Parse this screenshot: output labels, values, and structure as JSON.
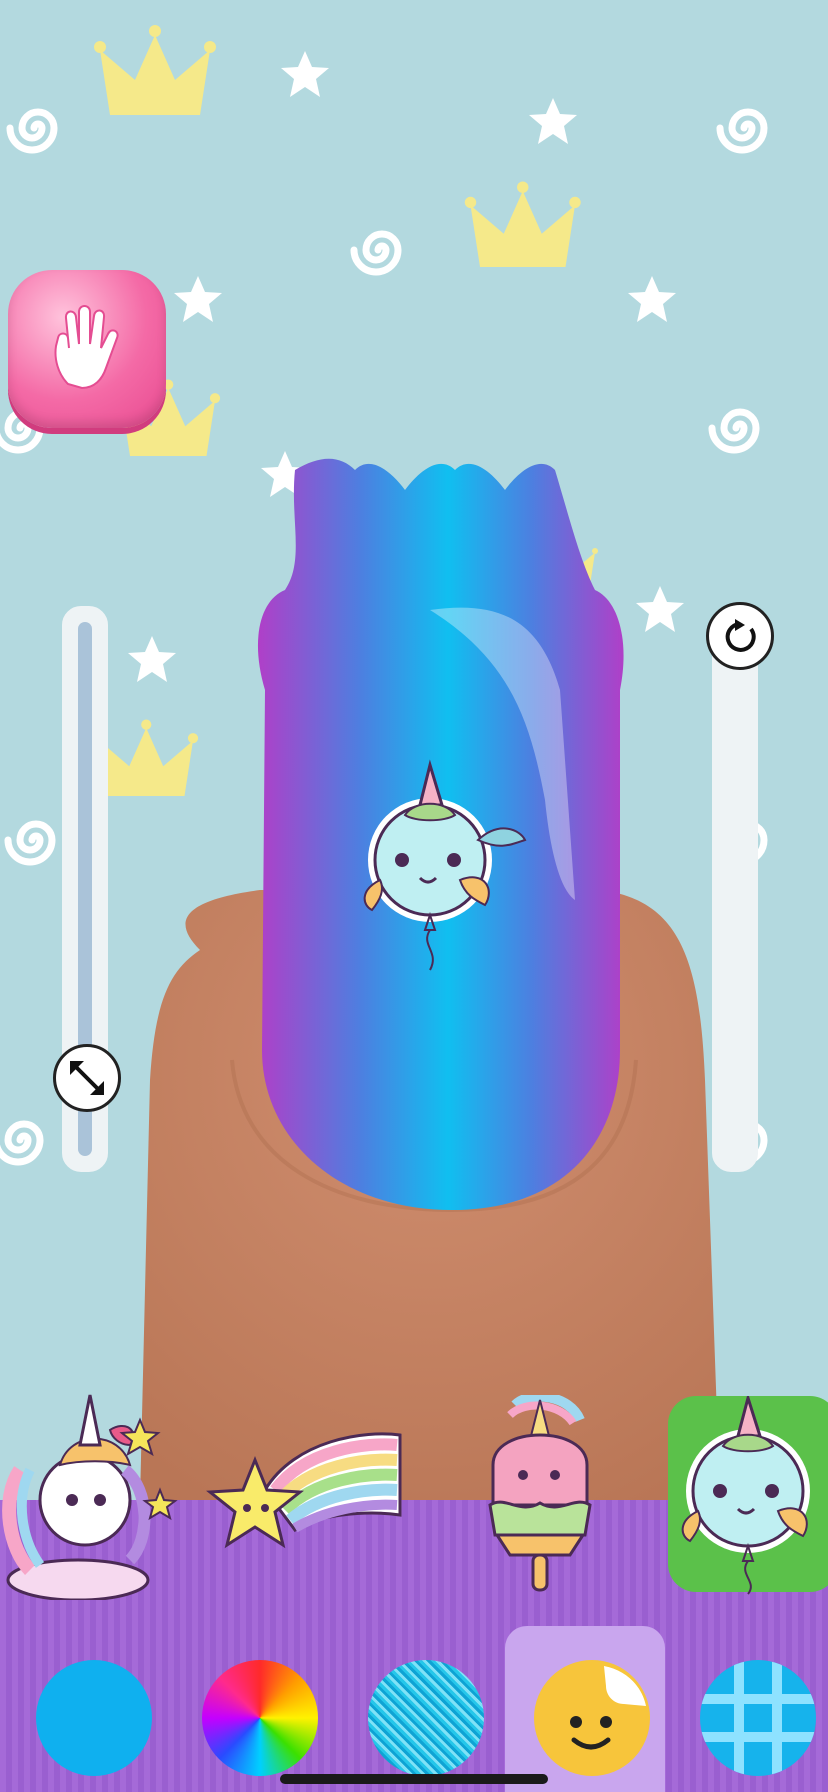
{
  "colors": {
    "background": "#b3d9df",
    "crown": "#f5e98a",
    "hand_button": "#f46aa6",
    "finger": "#c88464",
    "nail_edge": "#b03fc8",
    "nail_center": "#10bff0",
    "nail_mid": "#4d7fe0",
    "tray": "#a56ad8",
    "selected_sticker_bg": "#5bc14a",
    "solid_color_tool": "#0fb0ef"
  },
  "toolbar": {
    "hand_button_icon": "hand-icon",
    "size_slider_icon": "resize-arrows-icon",
    "rotate_slider_icon": "rotate-icon"
  },
  "sliders": {
    "size_level": 0.18,
    "rotate_level": 1.0
  },
  "nail": {
    "shape": "star-tip",
    "applied_sticker": "unicorn-balloon-sticker"
  },
  "sticker_tray": {
    "items": [
      {
        "icon": "unicorn-pony-sticker",
        "selected": false
      },
      {
        "icon": "rainbow-star-sticker",
        "selected": false
      },
      {
        "icon": "unicorn-icecream-sticker",
        "selected": false
      },
      {
        "icon": "unicorn-balloon-sticker",
        "selected": true
      }
    ]
  },
  "tools": {
    "items": [
      {
        "icon": "solid-color-icon",
        "selected": false
      },
      {
        "icon": "color-wheel-icon",
        "selected": false
      },
      {
        "icon": "glitter-icon",
        "selected": false
      },
      {
        "icon": "sticker-icon",
        "selected": true
      },
      {
        "icon": "pattern-grid-icon",
        "selected": false
      }
    ]
  }
}
